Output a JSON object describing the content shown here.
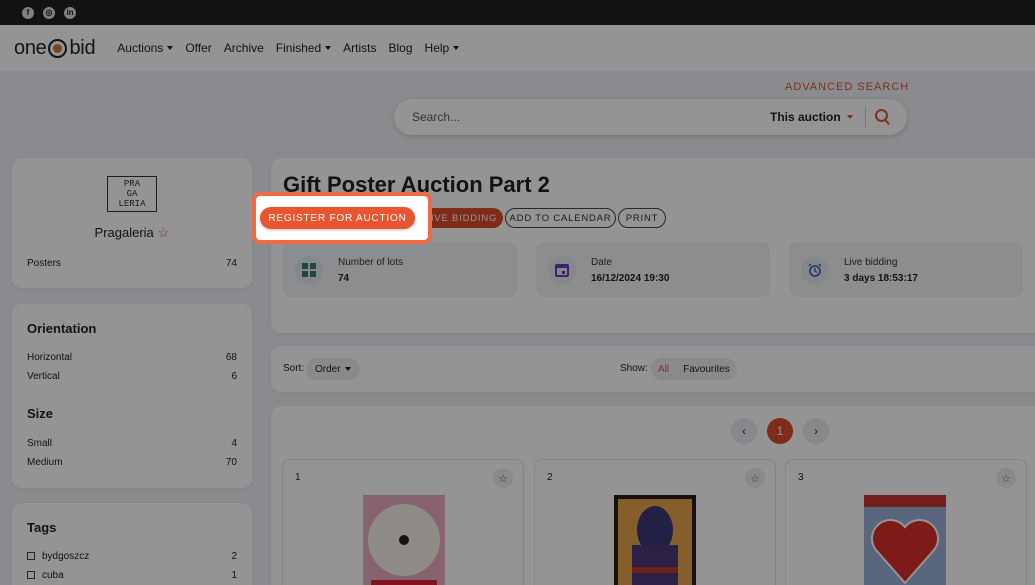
{
  "social": [
    "facebook-icon",
    "instagram-icon",
    "linkedin-icon"
  ],
  "nav": {
    "logo_left": "one",
    "logo_right": "bid",
    "items": [
      {
        "label": "Auctions",
        "dropdown": true
      },
      {
        "label": "Offer",
        "dropdown": false
      },
      {
        "label": "Archive",
        "dropdown": false
      },
      {
        "label": "Finished",
        "dropdown": true
      },
      {
        "label": "Artists",
        "dropdown": false
      },
      {
        "label": "Blog",
        "dropdown": false
      },
      {
        "label": "Help",
        "dropdown": true
      }
    ]
  },
  "search": {
    "advanced_label": "ADVANCED SEARCH",
    "placeholder": "Search...",
    "scope": "This auction"
  },
  "seller": {
    "logo_lines": [
      "PRA",
      "GA",
      "LERIA"
    ],
    "name": "Pragaleria",
    "category": "Posters",
    "count": "74"
  },
  "filters": {
    "orientation_title": "Orientation",
    "orientation": [
      {
        "label": "Horizontal",
        "count": "68"
      },
      {
        "label": "Vertical",
        "count": "6"
      }
    ],
    "size_title": "Size",
    "size": [
      {
        "label": "Small",
        "count": "4"
      },
      {
        "label": "Medium",
        "count": "70"
      }
    ],
    "tags_title": "Tags",
    "tags": [
      {
        "label": "bydgoszcz",
        "count": "2"
      },
      {
        "label": "cuba",
        "count": "1"
      }
    ]
  },
  "auction": {
    "title": "Gift Poster Auction Part 2",
    "register_label": "REGISTER FOR AUCTION",
    "live_label": "LIVE BIDDING",
    "calendar_label": "ADD TO CALENDAR",
    "print_label": "PRINT",
    "stats": [
      {
        "label": "Number of lots",
        "value": "74",
        "icon": "grid-icon"
      },
      {
        "label": "Date",
        "value": "16/12/2024 19:30",
        "icon": "calendar-icon"
      },
      {
        "label": "Live bidding",
        "value": "3 days 18:53:17",
        "icon": "alarm-clock-icon"
      }
    ]
  },
  "listing": {
    "sort_label": "Sort:",
    "sort_value": "Order",
    "show_label": "Show:",
    "show_options": [
      "All",
      "Favourites"
    ],
    "show_active": "All",
    "current_page": "1",
    "prev_glyph": "‹",
    "next_glyph": "›",
    "lots": [
      {
        "number": "1"
      },
      {
        "number": "2"
      },
      {
        "number": "3"
      }
    ]
  },
  "colors": {
    "accent": "#e0543a",
    "highlight_border": "#ef6a45"
  }
}
